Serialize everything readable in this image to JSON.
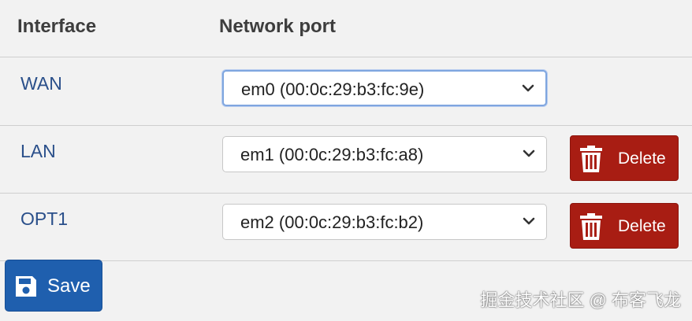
{
  "table": {
    "headers": {
      "interface": "Interface",
      "network_port": "Network port"
    },
    "rows": [
      {
        "interface": "WAN",
        "port": "em0 (00:0c:29:b3:fc:9e)",
        "focused": true,
        "delete_label": ""
      },
      {
        "interface": "LAN",
        "port": "em1 (00:0c:29:b3:fc:a8)",
        "focused": false,
        "delete_label": "Delete"
      },
      {
        "interface": "OPT1",
        "port": "em2 (00:0c:29:b3:fc:b2)",
        "focused": false,
        "delete_label": "Delete"
      }
    ]
  },
  "actions": {
    "save_label": "Save"
  },
  "watermark": "掘金技术社区 @ 布客飞龙",
  "icons": {
    "dropdown": "chevron-down-icon",
    "delete": "trash-icon",
    "save": "floppy-disk-icon"
  },
  "colors": {
    "delete_button": "#a81d13",
    "save_button": "#1f5fae",
    "interface_label": "#2a4f8a",
    "focus_border": "#7fa6df"
  }
}
